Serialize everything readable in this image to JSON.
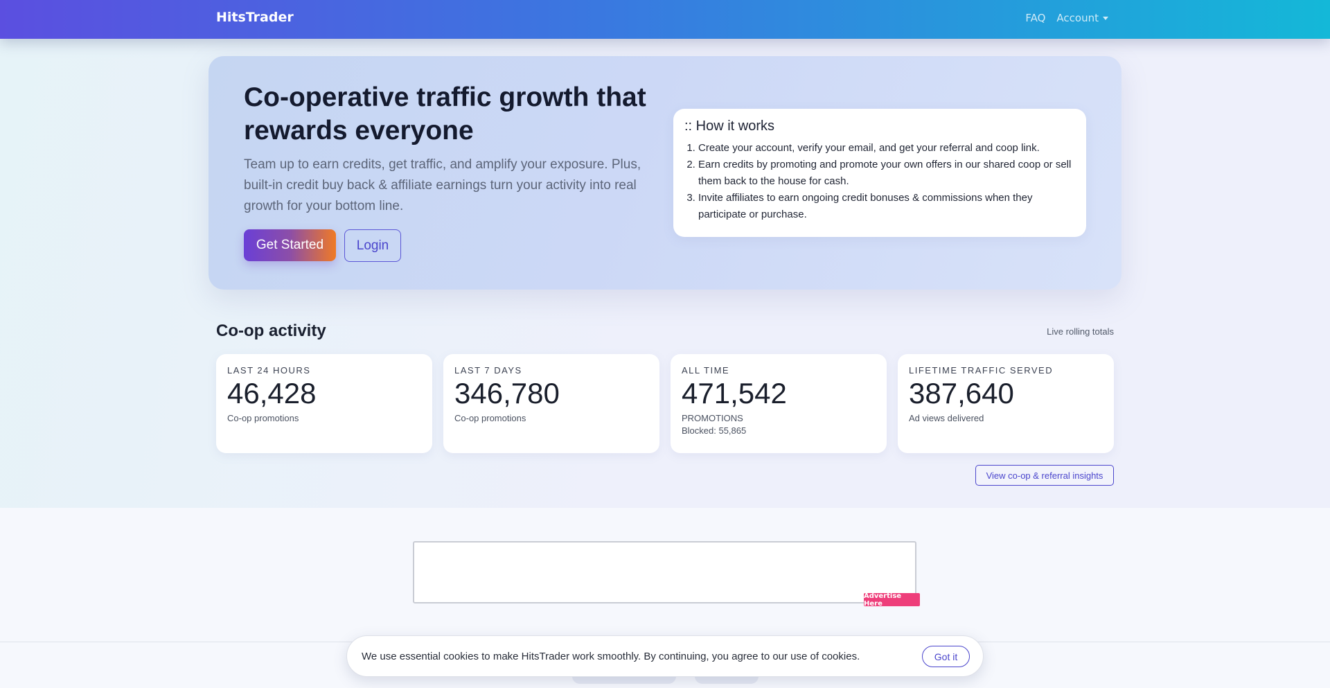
{
  "navbar": {
    "brand": "HitsTrader",
    "faq": "FAQ",
    "account": "Account"
  },
  "hero": {
    "title": "Co-operative traffic growth that rewards everyone",
    "subtitle": "Team up to earn credits, get traffic, and amplify your exposure. Plus, built-in credit buy back & affiliate earnings turn your activity into real growth for your bottom line.",
    "get_started": "Get Started",
    "login": "Login"
  },
  "how_it_works": {
    "title": ":: How it works",
    "steps": [
      "Create your account, verify your email, and get your referral and coop link.",
      "Earn credits by promoting and promote your own offers in our shared coop or sell them back to the house for cash.",
      "Invite affiliates to earn ongoing credit bonuses & commissions when they participate or purchase."
    ]
  },
  "coop": {
    "heading": "Co-op activity",
    "note": "Live rolling totals",
    "stats": [
      {
        "label": "LAST 24 HOURS",
        "value": "46,428",
        "desc": "Co-op promotions"
      },
      {
        "label": "LAST 7 DAYS",
        "value": "346,780",
        "desc": "Co-op promotions"
      },
      {
        "label": "ALL TIME",
        "value": "471,542",
        "desc": "PROMOTIONS",
        "extra": "Blocked: 55,865"
      },
      {
        "label": "LIFETIME TRAFFIC SERVED",
        "value": "387,640",
        "desc": "Ad views delivered"
      }
    ],
    "insights_button": "View co-op & referral insights"
  },
  "ad": {
    "badge": "Advertise Here"
  },
  "cookie": {
    "text": "We use essential cookies to make HitsTrader work smoothly. By continuing, you agree to our use of cookies.",
    "button": "Got it"
  },
  "colors": {
    "accent": "#4a45cc",
    "badge": "#ee3e7a"
  }
}
